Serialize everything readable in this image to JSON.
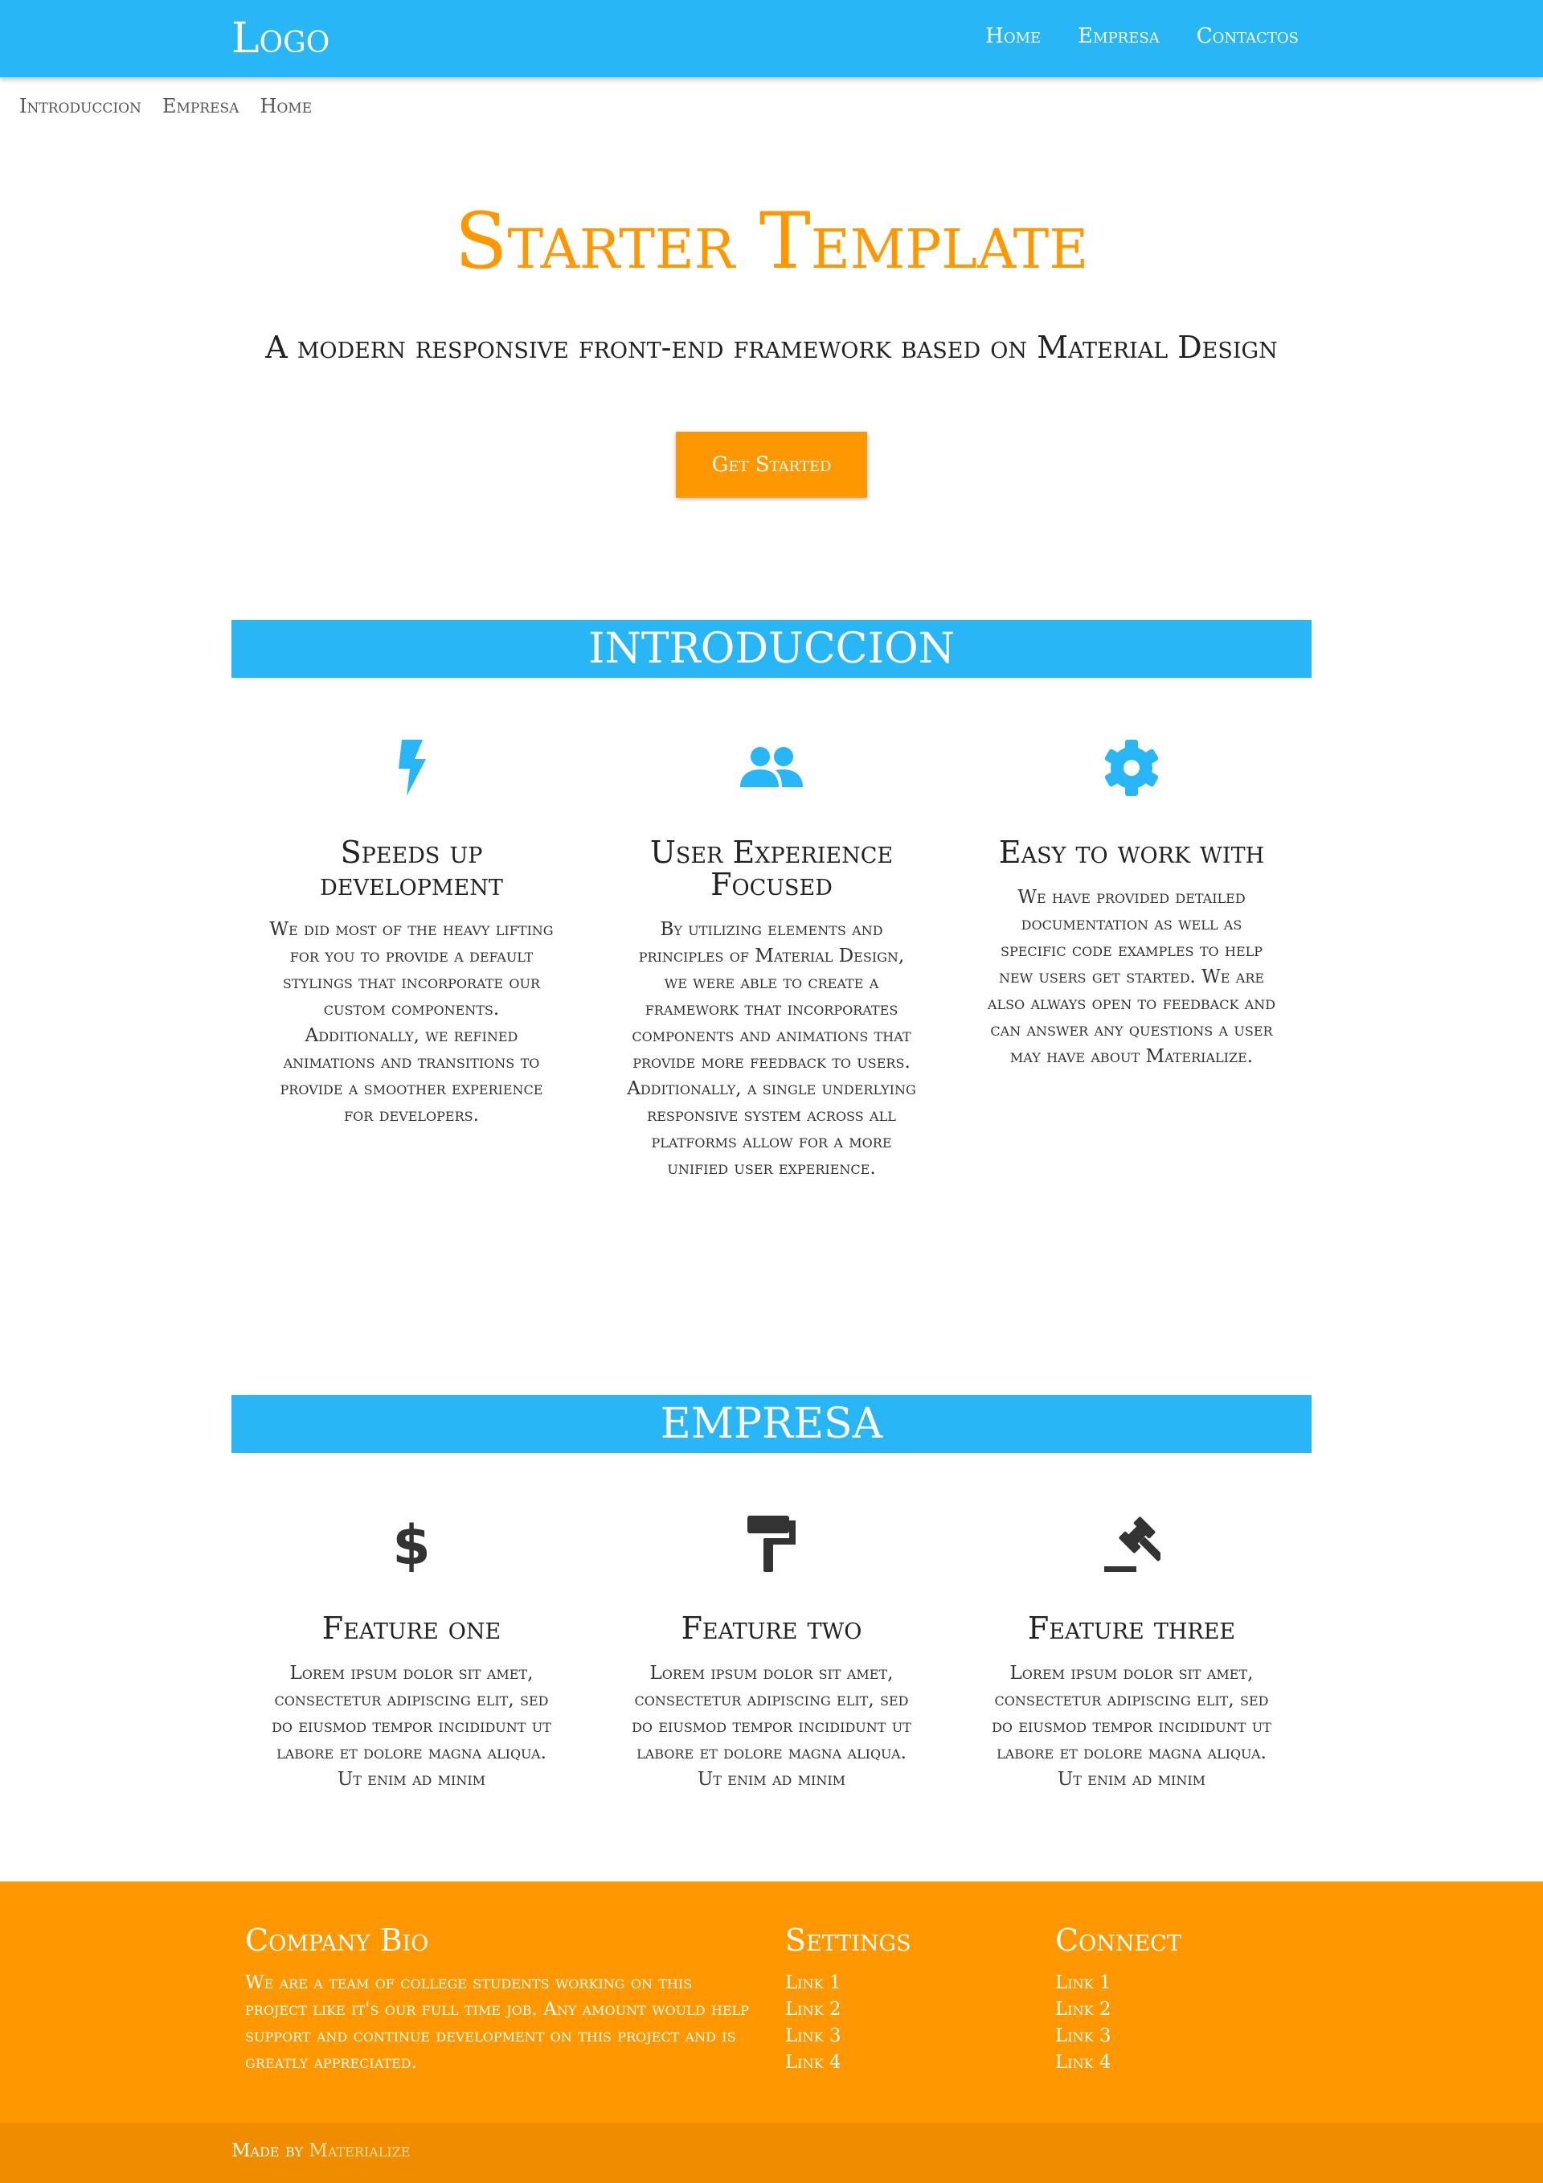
{
  "nav": {
    "logo": "Logo",
    "links": [
      "Home",
      "Empresa",
      "Contactos"
    ]
  },
  "subnav": [
    "Introduccion",
    "Empresa",
    "Home"
  ],
  "hero": {
    "title": "Starter Template",
    "subtitle": "A modern responsive front-end framework based on Material Design",
    "button": "Get Started"
  },
  "intro": {
    "heading": "INTRODUCCION",
    "features": [
      {
        "icon": "flash-icon",
        "title": "Speeds up development",
        "text": "We did most of the heavy lifting for you to provide a default stylings that incorporate our custom components. Additionally, we refined animations and transitions to provide a smoother experience for developers."
      },
      {
        "icon": "group-icon",
        "title": "User Experience Focused",
        "text": "By utilizing elements and principles of Material Design, we were able to create a framework that incorporates components and animations that provide more feedback to users. Additionally, a single underlying responsive system across all platforms allow for a more unified user experience."
      },
      {
        "icon": "settings-icon",
        "title": "Easy to work with",
        "text": "We have provided detailed documentation as well as specific code examples to help new users get started. We are also always open to feedback and can answer any questions a user may have about Materialize."
      }
    ]
  },
  "empresa": {
    "heading": "EMPRESA",
    "features": [
      {
        "icon": "dollar-icon",
        "title": "Feature one",
        "text": "Lorem ipsum dolor sit amet, consectetur adipiscing elit, sed do eiusmod tempor incididunt ut labore et dolore magna aliqua. Ut enim ad minim"
      },
      {
        "icon": "paint-roller-icon",
        "title": "Feature two",
        "text": "Lorem ipsum dolor sit amet, consectetur adipiscing elit, sed do eiusmod tempor incididunt ut labore et dolore magna aliqua. Ut enim ad minim"
      },
      {
        "icon": "gavel-icon",
        "title": "Feature three",
        "text": "Lorem ipsum dolor sit amet, consectetur adipiscing elit, sed do eiusmod tempor incididunt ut labore et dolore magna aliqua. Ut enim ad minim"
      }
    ]
  },
  "footer": {
    "bio_title": "Company Bio",
    "bio_text": "We are a team of college students working on this project like it's our full time job. Any amount would help support and continue development on this project and is greatly appreciated.",
    "settings_title": "Settings",
    "settings_links": [
      "Link 1",
      "Link 2",
      "Link 3",
      "Link 4"
    ],
    "connect_title": "Connect",
    "connect_links": [
      "Link 1",
      "Link 2",
      "Link 3",
      "Link 4"
    ],
    "made_by": "Made by",
    "made_link": "Materialize"
  },
  "colors": {
    "primary": "#29b6f6",
    "accent": "#ff9800",
    "icon_dark": "#333333"
  }
}
